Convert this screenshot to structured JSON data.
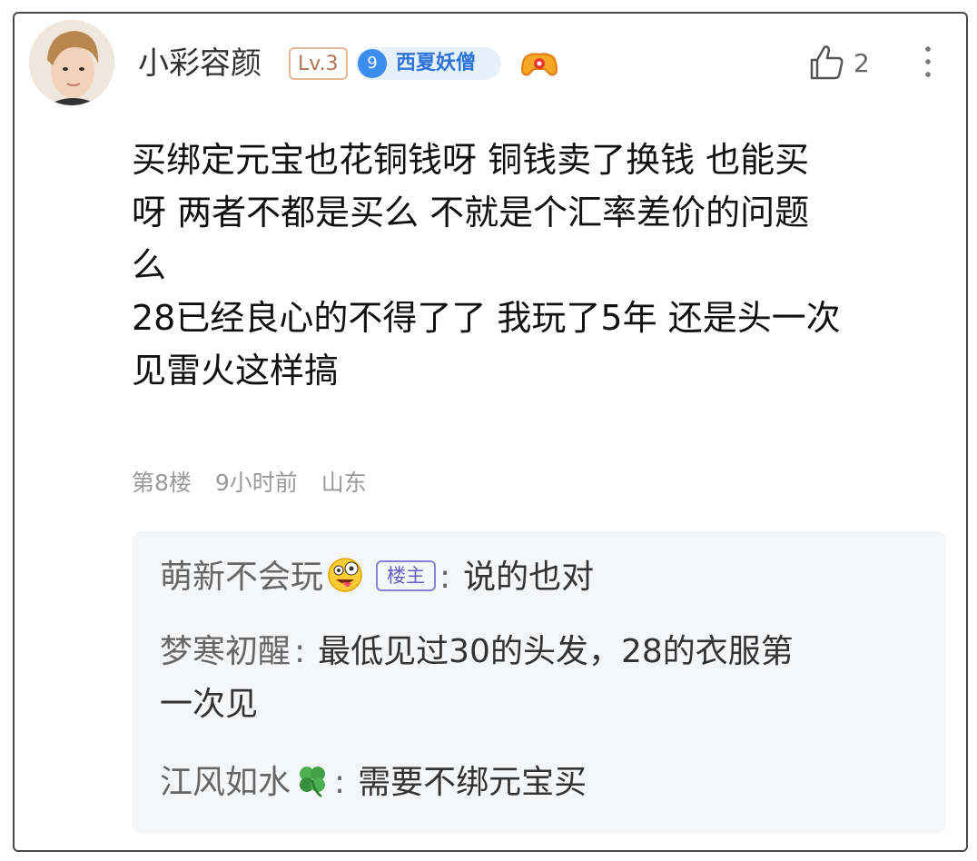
{
  "post": {
    "username": "小彩容颜",
    "level_badge": "Lv.3",
    "fan_badge": {
      "number": "9",
      "label": "西夏妖僧"
    },
    "like_count": "2",
    "content_lines": [
      "买绑定元宝也花铜钱呀 铜钱卖了换钱 也能买",
      "呀 两者不都是买么 不就是个汇率差价的问题",
      "么",
      "28已经良心的不得了了 我玩了5年 还是头一次",
      "见雷火这样搞"
    ],
    "meta": {
      "floor": "第8楼",
      "time": "9小时前",
      "location": "山东"
    }
  },
  "replies": [
    {
      "username": "萌新不会玩",
      "badge": "楼主",
      "colon": ":",
      "text": "说的也对"
    },
    {
      "username": "梦寒初醒",
      "colon": ":",
      "text": "最低见过30的头发，28的衣服第",
      "text_cont": "一次见"
    },
    {
      "username": "江风如水",
      "colon": ":",
      "text": "需要不绑元宝买"
    }
  ],
  "colors": {
    "accent_blue": "#3b8df0",
    "op_badge": "#6a5cc8",
    "level_badge": "#b07550"
  },
  "icons": [
    "avatar",
    "gamepad-icon",
    "thumbs-up-icon",
    "more-vertical-icon",
    "silly-face-emoji",
    "four-leaf-clover-emoji"
  ]
}
